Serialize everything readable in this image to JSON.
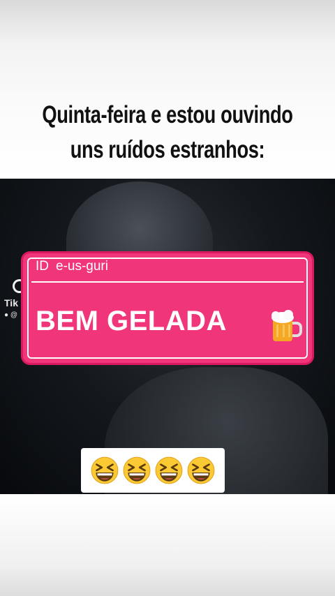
{
  "post": {
    "caption": "Quinta-feira e estou ouvindo uns ruídos estranhos:"
  },
  "watermark": {
    "brand": "Tik",
    "user": "@"
  },
  "card": {
    "id_label": "ID",
    "id_user": "e-us-guri",
    "text": "BEM GELADA",
    "icon": "beer-mug-icon",
    "colors": {
      "background": "#f0357a",
      "border": "#ffffff",
      "text": "#ffffff"
    }
  },
  "reaction": {
    "emojis": [
      "grinning-squinting-face-icon",
      "grinning-squinting-face-icon",
      "grinning-squinting-face-icon",
      "grinning-squinting-face-icon"
    ]
  }
}
